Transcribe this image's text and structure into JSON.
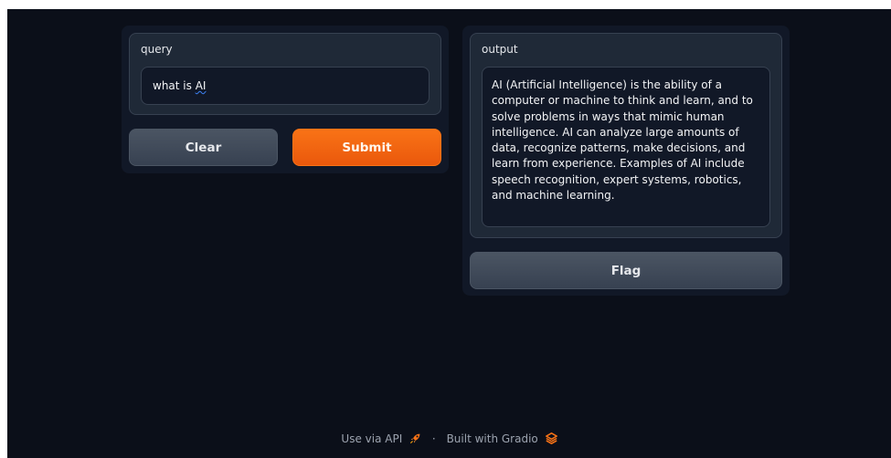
{
  "inputs": {
    "query_label": "query",
    "query_value_prefix": "what is ",
    "query_value_marked": "AI"
  },
  "buttons": {
    "clear_label": "Clear",
    "submit_label": "Submit",
    "flag_label": "Flag"
  },
  "outputs": {
    "output_label": "output",
    "output_text": "AI (Artificial Intelligence) is the ability of a computer or machine to think and learn, and to solve problems in ways that mimic human intelligence. AI can analyze large amounts of data, recognize patterns, make decisions, and learn from experience. Examples of AI include speech recognition, expert systems, robotics, and machine learning."
  },
  "footer": {
    "api_link": "Use via API",
    "separator": "·",
    "built_with": "Built with Gradio"
  },
  "colors": {
    "background": "#0b0f19",
    "panel": "#111827",
    "block": "#1f2937",
    "primary": "#f97316",
    "secondary": "#4b5563"
  },
  "icons": {
    "api": "rocket-icon",
    "gradio": "gradio-logo-icon"
  }
}
